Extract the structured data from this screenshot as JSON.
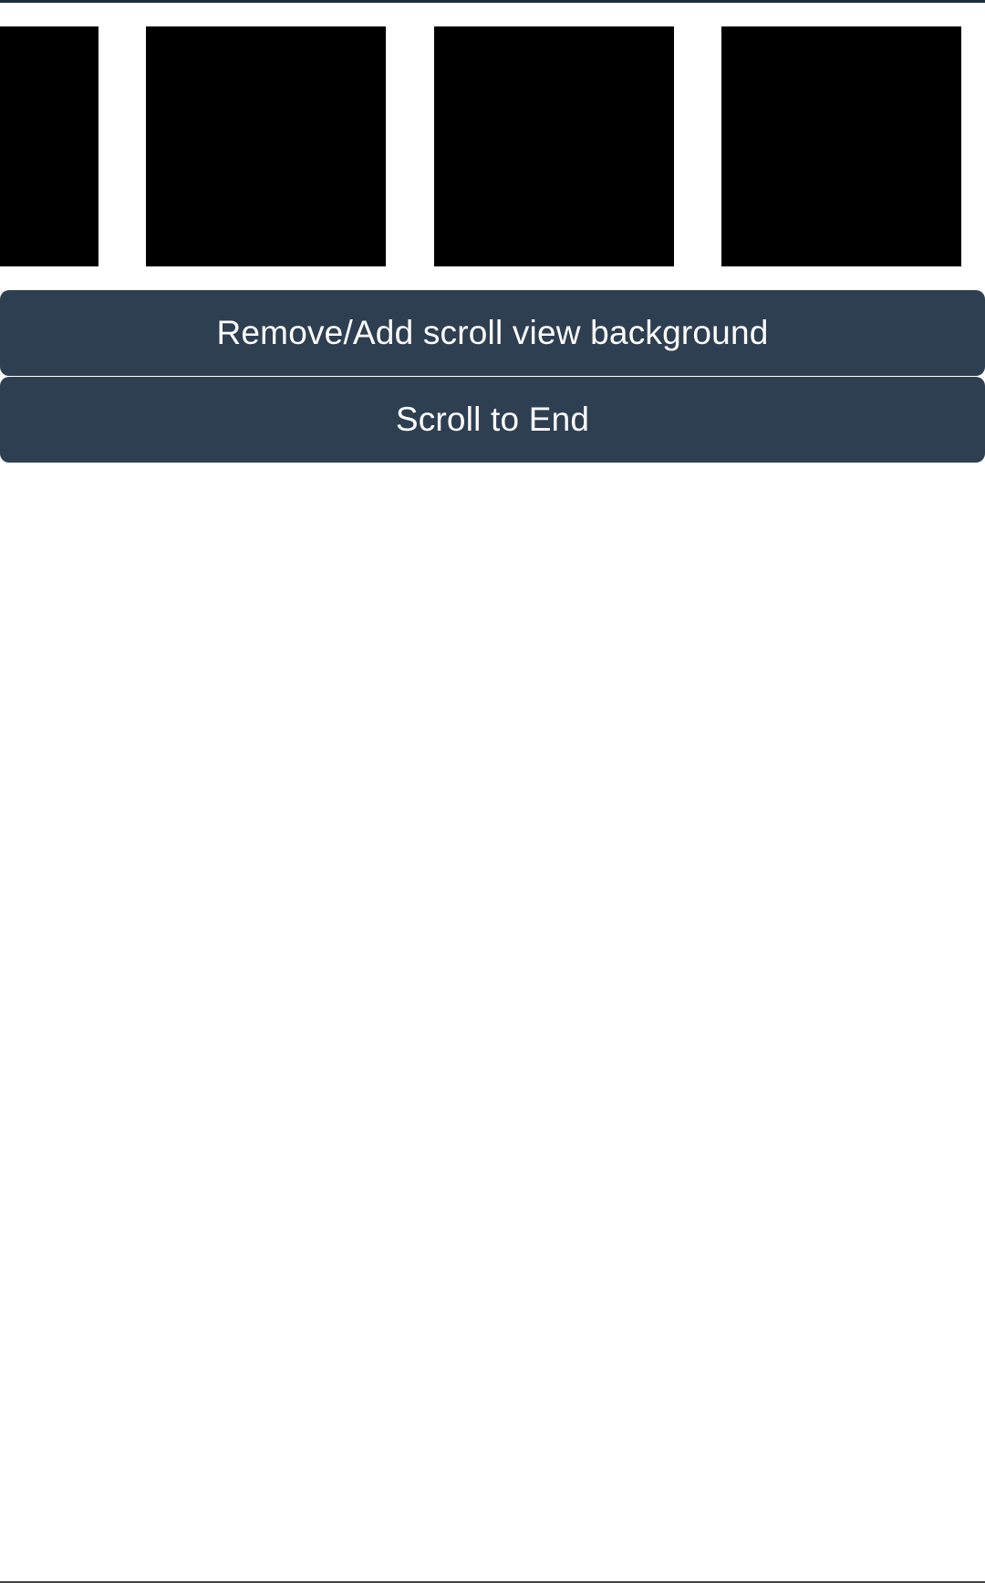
{
  "colors": {
    "top_rule": "#1c2b3b",
    "button_background": "#2f3f52",
    "button_text": "#ffffff",
    "tile": "#000000",
    "page_background": "#ffffff"
  },
  "scroll_view": {
    "item_count_visible": 4
  },
  "buttons": {
    "toggle_background_label": "Remove/Add scroll view background",
    "scroll_to_end_label": "Scroll to End"
  }
}
